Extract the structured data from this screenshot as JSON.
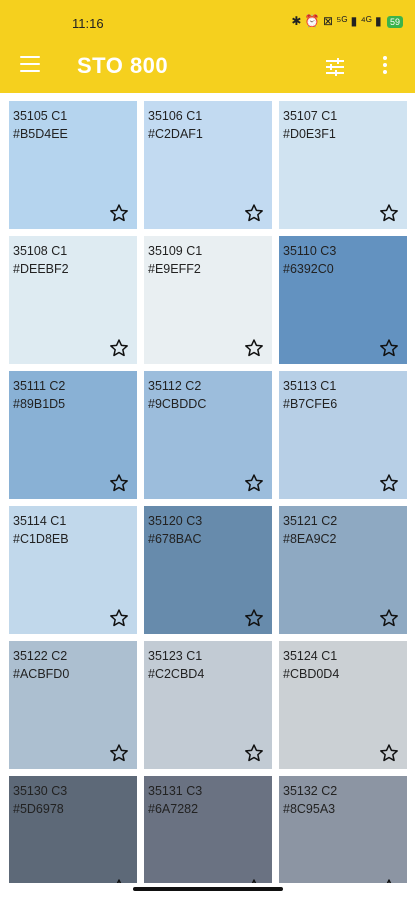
{
  "status_bar": {
    "time": "11:16",
    "icons_text": "✱ ⏰ ⊠ ⁵ᴳ ▮ ⁴ᴳ ▮",
    "battery": "59"
  },
  "app_bar": {
    "title": "STO 800"
  },
  "colors": {
    "accent": "#F5D01E"
  },
  "tiles": [
    {
      "name": "35105 C1",
      "hex": "#B5D4EE",
      "color": "#B5D4EE"
    },
    {
      "name": "35106 C1",
      "hex": "#C2DAF1",
      "color": "#C2DAF1"
    },
    {
      "name": "35107 C1",
      "hex": "#D0E3F1",
      "color": "#D0E3F1"
    },
    {
      "name": "35108 C1",
      "hex": "#DEEBF2",
      "color": "#DEEBF2"
    },
    {
      "name": "35109 C1",
      "hex": "#E9EFF2",
      "color": "#E9EFF2"
    },
    {
      "name": "35110 C3",
      "hex": "#6392C0",
      "color": "#6392C0"
    },
    {
      "name": "35111 C2",
      "hex": "#89B1D5",
      "color": "#89B1D5"
    },
    {
      "name": "35112 C2",
      "hex": "#9CBDDC",
      "color": "#9CBDDC"
    },
    {
      "name": "35113 C1",
      "hex": "#B7CFE6",
      "color": "#B7CFE6"
    },
    {
      "name": "35114 C1",
      "hex": "#C1D8EB",
      "color": "#C1D8EB"
    },
    {
      "name": "35120 C3",
      "hex": "#678BAC",
      "color": "#678BAC"
    },
    {
      "name": "35121 C2",
      "hex": "#8EA9C2",
      "color": "#8EA9C2"
    },
    {
      "name": "35122 C2",
      "hex": "#ACBFD0",
      "color": "#ACBFD0"
    },
    {
      "name": "35123 C1",
      "hex": "#C2CBD4",
      "color": "#C2CBD4"
    },
    {
      "name": "35124 C1",
      "hex": "#CBD0D4",
      "color": "#CBD0D4"
    },
    {
      "name": "35130 C3",
      "hex": "#5D6978",
      "color": "#5D6978"
    },
    {
      "name": "35131 C3",
      "hex": "#6A7282",
      "color": "#6A7282"
    },
    {
      "name": "35132 C2",
      "hex": "#8C95A3",
      "color": "#8C95A3"
    }
  ]
}
